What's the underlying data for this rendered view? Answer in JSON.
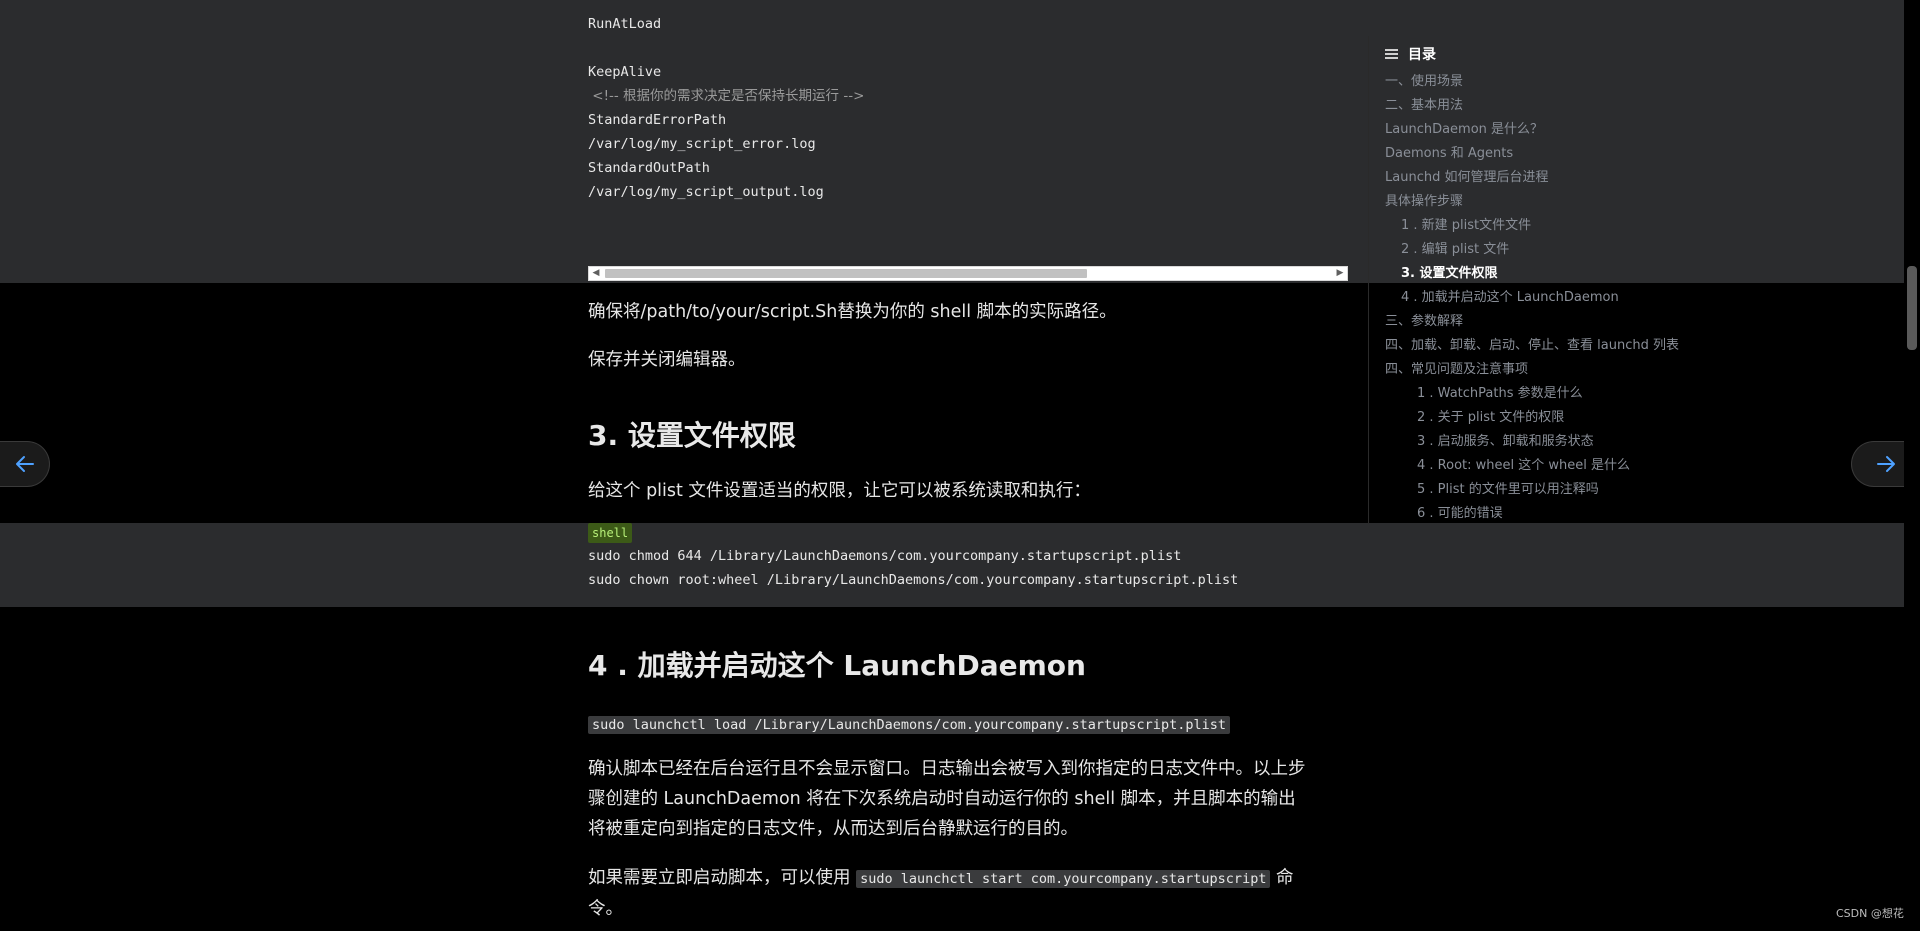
{
  "top_code": {
    "lines": [
      {
        "text": "RunAtLoad",
        "kind": "code"
      },
      {
        "text": "",
        "kind": "code"
      },
      {
        "text": "KeepAlive",
        "kind": "code"
      },
      {
        "text": " <!-- 根据你的需求决定是否保持长期运行 -->",
        "kind": "comment"
      },
      {
        "text": "StandardErrorPath",
        "kind": "code"
      },
      {
        "text": "/var/log/my_script_error.log",
        "kind": "code"
      },
      {
        "text": "StandardOutPath",
        "kind": "code"
      },
      {
        "text": "/var/log/my_script_output.log",
        "kind": "code"
      }
    ],
    "scroll_fraction": 0.55
  },
  "article": {
    "p1": "确保将/path/to/your/script.Sh替换为你的 shell 脚本的实际路径。",
    "p2": "保存并关闭编辑器。",
    "h_step3": "3. 设置文件权限",
    "p3": "给这个 plist 文件设置适当的权限，让它可以被系统读取和执行：",
    "shell_tag": "shell",
    "shell_lines": [
      "sudo chmod 644 /Library/LaunchDaemons/com.yourcompany.startupscript.plist",
      "sudo chown root:wheel /Library/LaunchDaemons/com.yourcompany.startupscript.plist"
    ],
    "h_step4": "4 . 加载并启动这个 LaunchDaemon",
    "load_cmd": "sudo launchctl load /Library/LaunchDaemons/com.yourcompany.startupscript.plist",
    "p4": "确认脚本已经在后台运行且不会显示窗口。日志输出会被写入到你指定的日志文件中。以上步骤创建的 LaunchDaemon 将在下次系统启动时自动运行你的 shell 脚本，并且脚本的输出将被重定向到指定的日志文件，从而达到后台静默运行的目的。",
    "p5_before": "如果需要立即启动脚本，可以使用 ",
    "p5_code": "sudo launchctl start com.yourcompany.startupscript",
    "p5_after": " 命令。"
  },
  "toc": {
    "title": "目录",
    "items": [
      {
        "label": "一、使用场景",
        "level": 1,
        "active": false
      },
      {
        "label": "二、基本用法",
        "level": 1,
        "active": false
      },
      {
        "label": "LaunchDaemon 是什么？",
        "level": 1,
        "active": false
      },
      {
        "label": "Daemons 和 Agents",
        "level": 1,
        "active": false
      },
      {
        "label": "Launchd 如何管理后台进程",
        "level": 1,
        "active": false
      },
      {
        "label": "具体操作步骤",
        "level": 1,
        "active": false
      },
      {
        "label": "1 . 新建 plist文件文件",
        "level": 2,
        "active": false
      },
      {
        "label": "2 . 编辑 plist 文件",
        "level": 2,
        "active": false
      },
      {
        "label": "3. 设置文件权限",
        "level": 2,
        "active": true
      },
      {
        "label": "4 . 加载并启动这个 LaunchDaemon",
        "level": 2,
        "active": false
      },
      {
        "label": "三、参数解释",
        "level": 1,
        "active": false
      },
      {
        "label": "四、加载、卸载、启动、停止、查看 launchd 列表",
        "level": 1,
        "active": false
      },
      {
        "label": "四、常见问题及注意事项",
        "level": 1,
        "active": false
      },
      {
        "label": "1 . WatchPaths 参数是什么",
        "level": 3,
        "active": false
      },
      {
        "label": "2 . 关于 plist 文件的权限",
        "level": 3,
        "active": false
      },
      {
        "label": "3 . 启动服务、卸载和服务状态",
        "level": 3,
        "active": false
      },
      {
        "label": "4 . Root: wheel 这个 wheel 是什么",
        "level": 3,
        "active": false
      },
      {
        "label": "5 . Plist 的文件里可以用注释吗",
        "level": 3,
        "active": false
      },
      {
        "label": "6 . 可能的错误",
        "level": 3,
        "active": false
      }
    ]
  },
  "nav": {
    "prev_icon": "arrow-left-icon",
    "next_icon": "arrow-right-icon",
    "accent": "#4ea1ff"
  },
  "watermark": "CSDN @想花"
}
